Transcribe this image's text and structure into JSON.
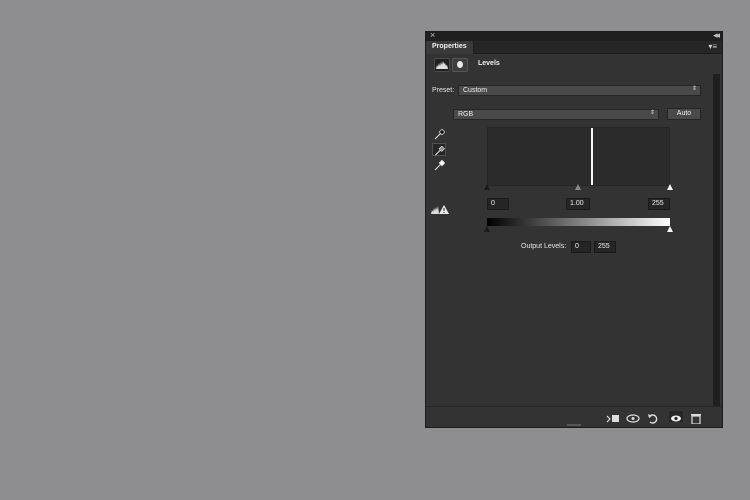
{
  "panel": {
    "title_tab": "Properties",
    "close_glyph": "×",
    "collapse_glyph": "◂◂",
    "menu_glyph": "▾≡",
    "adjustment_name": "Levels"
  },
  "preset": {
    "label": "Preset:",
    "value": "Custom"
  },
  "channel": {
    "value": "RGB"
  },
  "auto_button": "Auto",
  "input_levels": {
    "black": "0",
    "gamma": "1.00",
    "white": "255"
  },
  "output_levels": {
    "label": "Output Levels:",
    "black": "0",
    "white": "255"
  },
  "eyedroppers": [
    {
      "name": "black-point-eyedropper",
      "active": false
    },
    {
      "name": "gray-point-eyedropper",
      "active": true
    },
    {
      "name": "white-point-eyedropper",
      "active": false
    }
  ],
  "icons": {
    "adjustment": "levels-histogram-icon",
    "mask": "mask-icon",
    "warning": "histogram-warning-icon",
    "footer": [
      "clip-to-layer-icon",
      "view-previous-state-icon",
      "reset-icon",
      "visibility-eye-icon",
      "trash-icon"
    ]
  },
  "colors": {
    "panel_bg": "#333333",
    "desktop_bg": "#8e8e90",
    "field_bg": "#252525"
  }
}
